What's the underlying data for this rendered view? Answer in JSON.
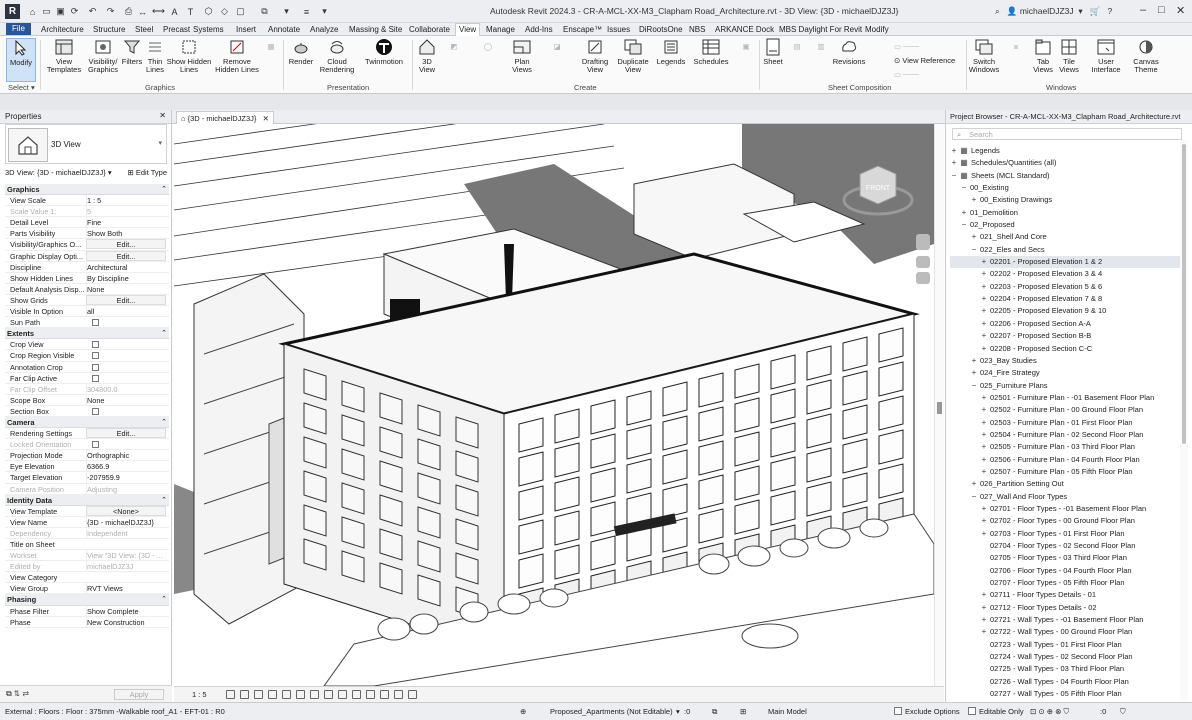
{
  "app": {
    "title": "Autodesk Revit 2024.3 - CR-A-MCL-XX-M3_Clapham Road_Architecture.rvt - 3D View: {3D - michaelDJZ3J}",
    "user": "michaelDJZ3J",
    "logo": "R"
  },
  "menu_tabs": [
    "File",
    "Architecture",
    "Structure",
    "Steel",
    "Precast",
    "Systems",
    "Insert",
    "Annotate",
    "Analyze",
    "Massing & Site",
    "Collaborate",
    "View",
    "Manage",
    "Add-Ins",
    "Enscape™",
    "Issues",
    "DiRootsOne",
    "NBS",
    "ARKANCE Dock",
    "MBS Daylight For Revit",
    "Modify"
  ],
  "active_tab": "View",
  "ribbon": {
    "modify": "Modify",
    "select": "Select",
    "graphics": {
      "view_templates": "View Templates",
      "visibility_graphics": "Visibility/ Graphics",
      "filters": "Filters",
      "thin_lines": "Thin Lines",
      "show_hidden_lines": "Show Hidden Lines",
      "remove_hidden_lines": "Remove Hidden Lines",
      "label": "Graphics"
    },
    "presentation": {
      "render": "Render",
      "cloud_rendering": "Cloud Rendering",
      "twinmotion": "Twinmotion",
      "label": "Presentation"
    },
    "create": {
      "view_3d": "3D View",
      "plan_views": "Plan Views",
      "drafting_view": "Drafting View",
      "duplicate_view": "Duplicate View",
      "legends": "Legends",
      "schedules": "Schedules",
      "label": "Create"
    },
    "sheet": {
      "sheet": "Sheet",
      "revisions": "Revisions",
      "view_reference": "View Reference",
      "label": "Sheet Composition"
    },
    "windows": {
      "switch_windows": "Switch Windows",
      "tab_views": "Tab Views",
      "tile_views": "Tile Views",
      "user_interface": "User Interface",
      "canvas_theme": "Canvas Theme",
      "label": "Windows"
    }
  },
  "properties": {
    "header": "Properties",
    "type_name": "3D View",
    "instance": "3D View: {3D - michaelDJZ3J}",
    "edit_type": "Edit Type",
    "apply": "Apply",
    "rows": [
      {
        "section": "Graphics"
      },
      {
        "k": "View Scale",
        "v": "1 : 5"
      },
      {
        "k": "Scale Value    1:",
        "v": "5",
        "dis": true
      },
      {
        "k": "Detail Level",
        "v": "Fine"
      },
      {
        "k": "Parts Visibility",
        "v": "Show Both"
      },
      {
        "k": "Visibility/Graphics O...",
        "v": "Edit...",
        "btn": true
      },
      {
        "k": "Graphic Display Opti...",
        "v": "Edit...",
        "btn": true
      },
      {
        "k": "Discipline",
        "v": "Architectural"
      },
      {
        "k": "Show Hidden Lines",
        "v": "By Discipline"
      },
      {
        "k": "Default Analysis Disp...",
        "v": "None"
      },
      {
        "k": "Show Grids",
        "v": "Edit...",
        "btn": true
      },
      {
        "k": "Visible In Option",
        "v": "all"
      },
      {
        "k": "Sun Path",
        "chk": true
      },
      {
        "section": "Extents"
      },
      {
        "k": "Crop View",
        "chk": true
      },
      {
        "k": "Crop Region Visible",
        "chk": true
      },
      {
        "k": "Annotation Crop",
        "chk": true
      },
      {
        "k": "Far Clip Active",
        "chk": true
      },
      {
        "k": "Far Clip Offset",
        "v": "304800.0",
        "dis": true
      },
      {
        "k": "Scope Box",
        "v": "None"
      },
      {
        "k": "Section Box",
        "chk": true
      },
      {
        "section": "Camera"
      },
      {
        "k": "Rendering Settings",
        "v": "Edit...",
        "btn": true
      },
      {
        "k": "Locked Orientation",
        "dis": true,
        "chk": true
      },
      {
        "k": "Projection Mode",
        "v": "Orthographic"
      },
      {
        "k": "Eye Elevation",
        "v": "6366.9"
      },
      {
        "k": "Target Elevation",
        "v": "-207959.9"
      },
      {
        "k": "Camera Position",
        "v": "Adjusting",
        "dis": true
      },
      {
        "section": "Identity Data"
      },
      {
        "k": "View Template",
        "v": "<None>",
        "btn": true
      },
      {
        "k": "View Name",
        "v": "{3D - michaelDJZ3J}"
      },
      {
        "k": "Dependency",
        "v": "Independent",
        "dis": true
      },
      {
        "k": "Title on Sheet",
        "v": ""
      },
      {
        "k": "Workset",
        "v": "View \"3D View: {3D - ...",
        "dis": true
      },
      {
        "k": "Edited by",
        "v": "michaelDJZ3J",
        "dis": true
      },
      {
        "k": "View Category",
        "v": ""
      },
      {
        "k": "View Group",
        "v": "RVT Views"
      },
      {
        "section": "Phasing"
      },
      {
        "k": "Phase Filter",
        "v": "Show Complete"
      },
      {
        "k": "Phase",
        "v": "New Construction"
      }
    ]
  },
  "view_tab": "{3D - michaelDJZ3J}",
  "view_scale": "1 : 5",
  "viewcube_face": "FRONT",
  "browser": {
    "header": "Project Browser - CR-A-MCL-XX-M3_Clapham Road_Architecture.rvt",
    "search_placeholder": "Search",
    "nodes": [
      {
        "t": "Legends",
        "d": 0,
        "g": "+",
        "ic": true
      },
      {
        "t": "Schedules/Quantities (all)",
        "d": 0,
        "g": "+",
        "ic": true
      },
      {
        "t": "Sheets (MCL Standard)",
        "d": 0,
        "g": "−",
        "ic": true
      },
      {
        "t": "00_Existing",
        "d": 1,
        "g": "−"
      },
      {
        "t": "00_Existing Drawings",
        "d": 2,
        "g": "+"
      },
      {
        "t": "01_Demolition",
        "d": 1,
        "g": "+"
      },
      {
        "t": "02_Proposed",
        "d": 1,
        "g": "−"
      },
      {
        "t": "021_Shell And Core",
        "d": 2,
        "g": "+"
      },
      {
        "t": "022_Eles and Secs",
        "d": 2,
        "g": "−"
      },
      {
        "t": "02201 - Proposed Elevation 1 & 2",
        "d": 3,
        "g": "+",
        "hl": true
      },
      {
        "t": "02202 - Proposed Elevation 3 & 4",
        "d": 3,
        "g": "+"
      },
      {
        "t": "02203 - Proposed Elevation 5 & 6",
        "d": 3,
        "g": "+"
      },
      {
        "t": "02204 - Proposed Elevation 7 & 8",
        "d": 3,
        "g": "+"
      },
      {
        "t": "02205 - Proposed Elevation 9 & 10",
        "d": 3,
        "g": "+"
      },
      {
        "t": "02206 - Proposed Section A-A",
        "d": 3,
        "g": "+"
      },
      {
        "t": "02207 - Proposed Section B-B",
        "d": 3,
        "g": "+"
      },
      {
        "t": "02208 - Proposed Section C-C",
        "d": 3,
        "g": "+"
      },
      {
        "t": "023_Bay Studies",
        "d": 2,
        "g": "+"
      },
      {
        "t": "024_Fire Strategy",
        "d": 2,
        "g": "+"
      },
      {
        "t": "025_Furniture Plans",
        "d": 2,
        "g": "−"
      },
      {
        "t": "02501 - Furniture Plan - -01 Basement Floor Plan",
        "d": 3,
        "g": "+"
      },
      {
        "t": "02502 - Furniture Plan - 00 Ground Floor Plan",
        "d": 3,
        "g": "+"
      },
      {
        "t": "02503 - Furniture Plan - 01 First Floor Plan",
        "d": 3,
        "g": "+"
      },
      {
        "t": "02504 - Furniture Plan - 02 Second Floor Plan",
        "d": 3,
        "g": "+"
      },
      {
        "t": "02505 - Furniture Plan - 03 Third Floor Plan",
        "d": 3,
        "g": "+"
      },
      {
        "t": "02506 - Furniture Plan - 04 Fourth Floor Plan",
        "d": 3,
        "g": "+"
      },
      {
        "t": "02507 - Furniture Plan - 05 Fifth Floor Plan",
        "d": 3,
        "g": "+"
      },
      {
        "t": "026_Partition Setting Out",
        "d": 2,
        "g": "+"
      },
      {
        "t": "027_Wall And Floor Types",
        "d": 2,
        "g": "−"
      },
      {
        "t": "02701 - Floor Types - -01 Basement Floor Plan",
        "d": 3,
        "g": "+"
      },
      {
        "t": "02702 - Floor Types - 00 Ground Floor Plan",
        "d": 3,
        "g": "+"
      },
      {
        "t": "02703 - Floor Types - 01 First Floor Plan",
        "d": 3,
        "g": "+"
      },
      {
        "t": "02704 - Floor Types - 02 Second Floor Plan",
        "d": 3,
        "g": ""
      },
      {
        "t": "02705 - Floor Types - 03 Third Floor Plan",
        "d": 3,
        "g": ""
      },
      {
        "t": "02706 - Floor Types - 04 Fourth Floor Plan",
        "d": 3,
        "g": ""
      },
      {
        "t": "02707 - Floor Types - 05 Fifth Floor Plan",
        "d": 3,
        "g": ""
      },
      {
        "t": "02711 - Floor Types Details - 01",
        "d": 3,
        "g": "+"
      },
      {
        "t": "02712 - Floor Types Details - 02",
        "d": 3,
        "g": "+"
      },
      {
        "t": "02721 - Wall Types - -01 Basement Floor Plan",
        "d": 3,
        "g": "+"
      },
      {
        "t": "02722 - Wall Types - 00 Ground Floor Plan",
        "d": 3,
        "g": "+"
      },
      {
        "t": "02723 - Wall Types - 01 First Floor Plan",
        "d": 3,
        "g": ""
      },
      {
        "t": "02724 - Wall Types - 02 Second Floor Plan",
        "d": 3,
        "g": ""
      },
      {
        "t": "02725 - Wall Types - 03 Third Floor Plan",
        "d": 3,
        "g": ""
      },
      {
        "t": "02726 - Wall Types - 04 Fourth Floor Plan",
        "d": 3,
        "g": ""
      },
      {
        "t": "02727 - Wall Types - 05 Fifth Floor Plan",
        "d": 3,
        "g": ""
      }
    ]
  },
  "status": {
    "text": "External : Floors : Floor : 375mm -Walkable roof_A1 - EFT-01 : R0",
    "workset": "Proposed_Apartments (Not Editable)",
    "workset_count": ":0",
    "model": "Main Model",
    "exclude_options": "Exclude Options",
    "editable_only": "Editable Only",
    "filter_count": ":0"
  },
  "colors": {
    "file_tab": "#2b579a",
    "panel_bg": "#eceef1",
    "highlight": "#e3e6ea"
  }
}
